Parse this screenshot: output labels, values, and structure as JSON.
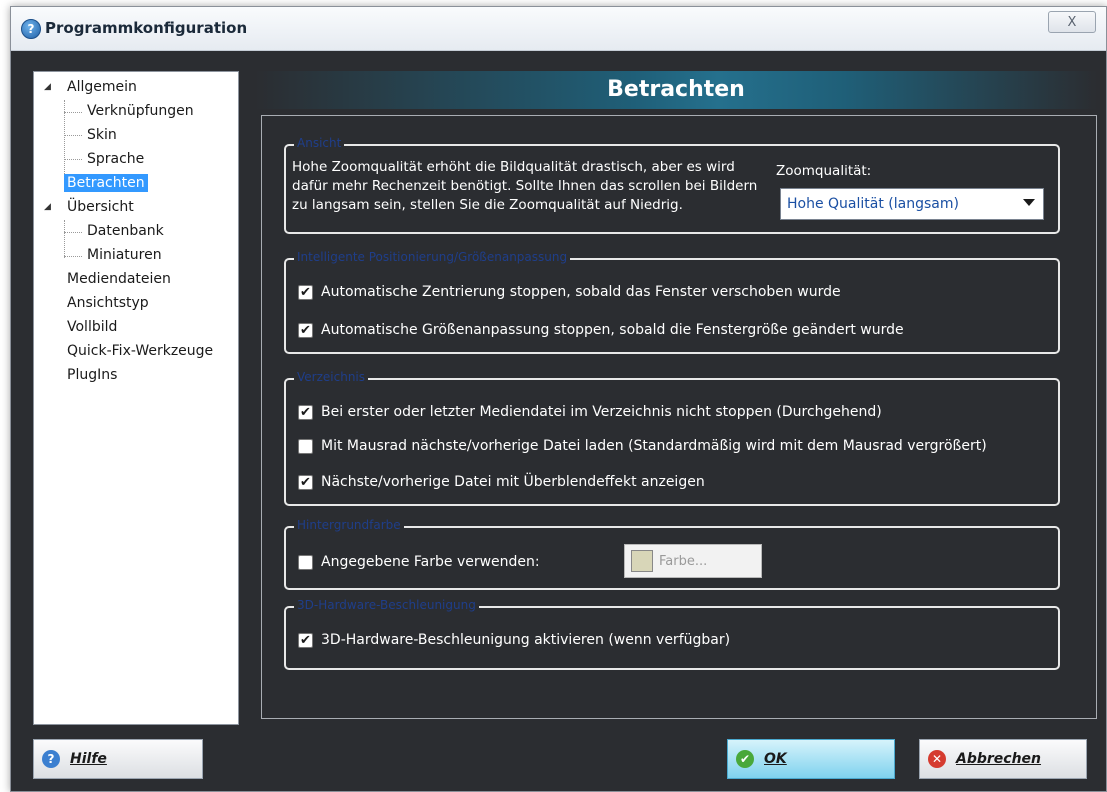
{
  "window": {
    "title": "Programmkonfiguration",
    "app_icon": "app-icon",
    "close_label": "X"
  },
  "tree": {
    "items": [
      {
        "label": "Allgemein"
      },
      {
        "label": "Verknüpfungen"
      },
      {
        "label": "Skin"
      },
      {
        "label": "Sprache"
      },
      {
        "label": "Betrachten"
      },
      {
        "label": "Übersicht"
      },
      {
        "label": "Datenbank"
      },
      {
        "label": "Miniaturen"
      },
      {
        "label": "Mediendateien"
      },
      {
        "label": "Ansichtstyp"
      },
      {
        "label": "Vollbild"
      },
      {
        "label": "Quick-Fix-Werkzeuge"
      },
      {
        "label": "PlugIns"
      }
    ],
    "selected": "Betrachten"
  },
  "header": {
    "title": "Betrachten"
  },
  "groups": {
    "ansicht": {
      "legend": "Ansicht",
      "description": "Hohe Zoomqualität erhöht die Bildqualität drastisch, aber es wird dafür mehr Rechenzeit benötigt. Sollte Ihnen das scrollen bei Bildern zu langsam sein, stellen Sie die Zoomqualität auf Niedrig.",
      "zoom_label": "Zoomqualität:",
      "zoom_value": "Hohe Qualität (langsam)"
    },
    "positionierung": {
      "legend": "Intelligente Positionierung/Größenanpassung",
      "options": [
        {
          "label": "Automatische Zentrierung stoppen, sobald das Fenster verschoben wurde",
          "checked": true
        },
        {
          "label": "Automatische Größenanpassung stoppen, sobald die Fenstergröße geändert wurde",
          "checked": true
        }
      ]
    },
    "verzeichnis": {
      "legend": "Verzeichnis",
      "options": [
        {
          "label": "Bei erster oder letzter Mediendatei im Verzeichnis nicht stoppen (Durchgehend)",
          "checked": true
        },
        {
          "label": "Mit Mausrad nächste/vorherige Datei laden (Standardmäßig wird mit dem Mausrad vergrößert)",
          "checked": false
        },
        {
          "label": "Nächste/vorherige Datei mit Überblendeffekt anzeigen",
          "checked": true
        }
      ]
    },
    "hintergrund": {
      "legend": "Hintergrundfarbe",
      "option": {
        "label": "Angegebene Farbe verwenden:",
        "checked": false
      },
      "color_button": "Farbe...",
      "swatch_color": "#d8d6b8"
    },
    "hardware": {
      "legend": "3D-Hardware-Beschleunigung",
      "option": {
        "label": "3D-Hardware-Beschleunigung aktivieren (wenn verfügbar)",
        "checked": true
      }
    }
  },
  "buttons": {
    "help": "Hilfe",
    "ok": "OK",
    "cancel": "Abbrechen"
  },
  "colors": {
    "background": "#2b2d31",
    "selection": "#3399ff",
    "header_accent": "#25708d"
  }
}
